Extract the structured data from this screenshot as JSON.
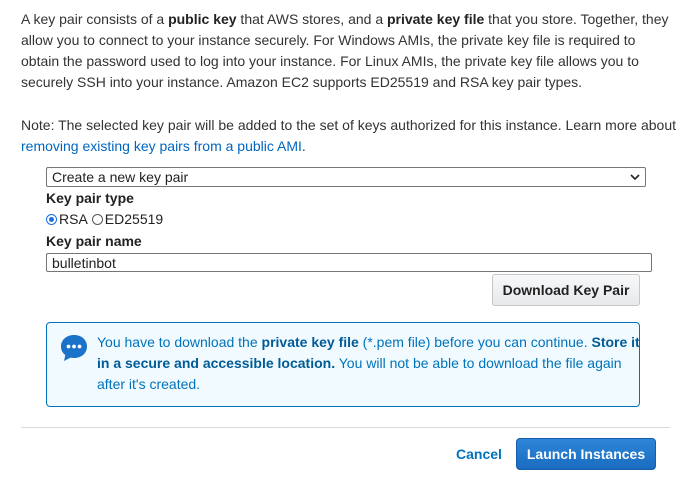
{
  "intro": {
    "t1": "A key pair consists of a ",
    "b1": "public key",
    "t2": " that AWS stores, and a ",
    "b2": "private key file",
    "t3": " that you store. Together, they allow you to connect to your instance securely. For Windows AMIs, the private key file is required to obtain the password used to log into your instance. For Linux AMIs, the private key file allows you to securely SSH into your instance. Amazon EC2 supports ED25519 and RSA key pair types."
  },
  "note": {
    "t1": "Note: The selected key pair will be added to the set of keys authorized for this instance. Learn more about ",
    "link": "removing existing key pairs from a public AMI",
    "t2": "."
  },
  "key_pair_select": {
    "value": "Create a new key pair"
  },
  "key_pair_type": {
    "label": "Key pair type",
    "options": [
      "RSA",
      "ED25519"
    ],
    "selected": "RSA"
  },
  "key_pair_name": {
    "label": "Key pair name",
    "value": "bulletinbot"
  },
  "download_button": "Download Key Pair",
  "info": {
    "t1": "You have to download the ",
    "b1": "private key file",
    "t2": " (*.pem file) before you can continue. ",
    "b2": "Store it in a secure and accessible location.",
    "t3": " You will not be able to download the file again after it's created."
  },
  "footer": {
    "cancel": "Cancel",
    "launch": "Launch Instances"
  },
  "colors": {
    "link": "#0073bb",
    "primary_button": "#1a6cc0",
    "info_background": "#f1faff"
  }
}
